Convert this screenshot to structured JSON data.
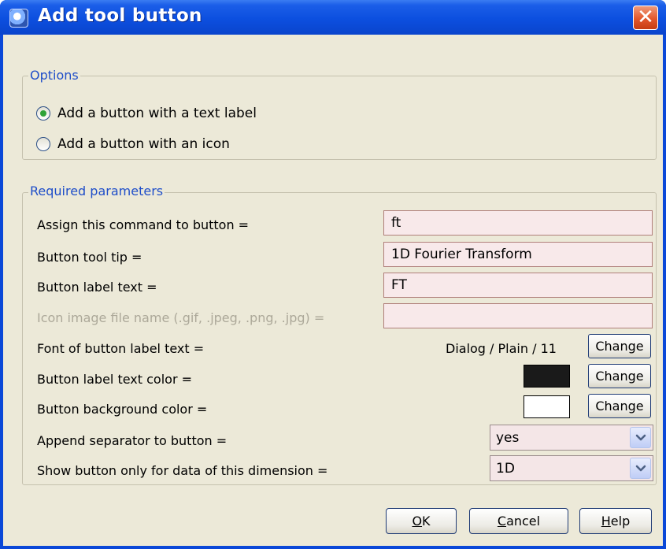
{
  "window": {
    "title": "Add tool button",
    "close_glyph": "✕"
  },
  "options": {
    "legend": "Options",
    "radios": [
      {
        "label": "Add a button with a text label",
        "selected": true
      },
      {
        "label": "Add a button with an icon",
        "selected": false
      }
    ]
  },
  "params": {
    "legend": "Required parameters",
    "command_label": "Assign this command to button =",
    "command_value": "ft",
    "tooltip_label": "Button tool tip =",
    "tooltip_value": "1D Fourier Transform",
    "label_text_label": "Button label text =",
    "label_text_value": "FT",
    "icon_file_label": "Icon image file name (.gif, .jpeg, .png, .jpg) =",
    "icon_file_value": "",
    "font_label": "Font of button label text =",
    "font_value": "Dialog / Plain / 11",
    "text_color_label": "Button label text color =",
    "text_color": "#1a1a1a",
    "bg_color_label": "Button background color =",
    "bg_color": "#ffffff",
    "change_label": "Change",
    "separator_label": "Append separator to button =",
    "separator_value": "yes",
    "dimension_label": "Show button only for data of this dimension =",
    "dimension_value": "1D"
  },
  "buttons": {
    "ok_mnemonic": "O",
    "ok_rest": "K",
    "cancel_mnemonic": "C",
    "cancel_rest": "ancel",
    "help_mnemonic": "H",
    "help_rest": "elp"
  }
}
